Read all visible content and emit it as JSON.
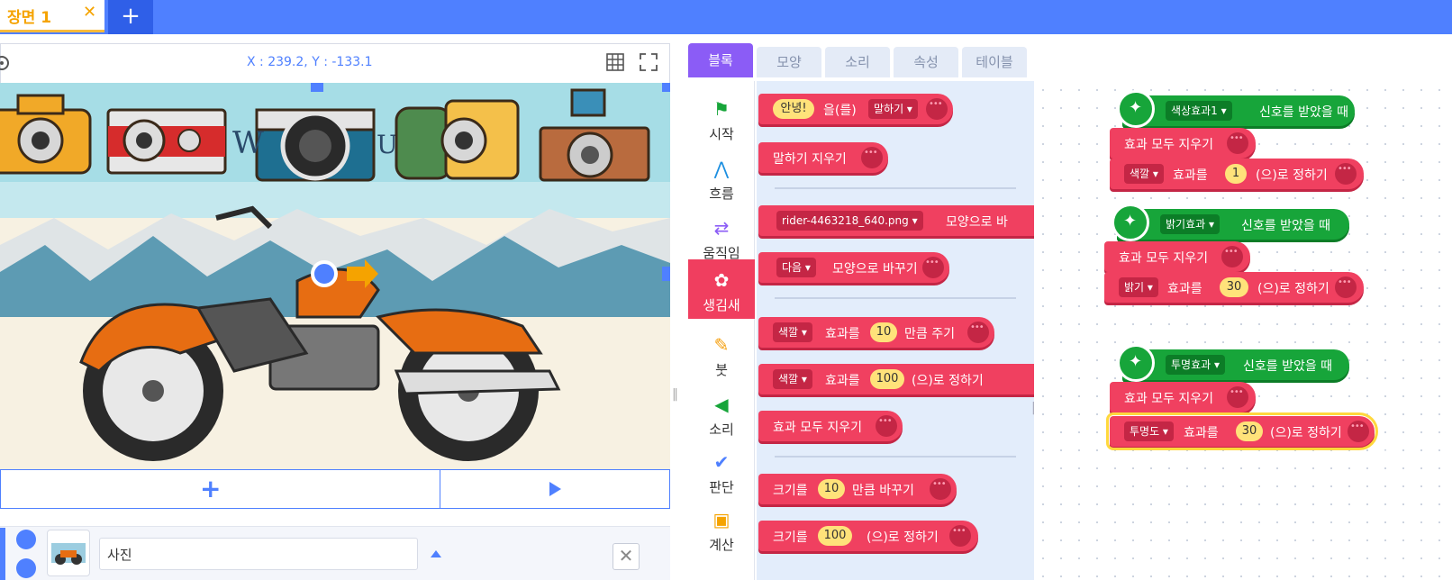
{
  "scene_tab": {
    "label": "장면 1",
    "close": "✕",
    "add": "+"
  },
  "stage": {
    "coords": "X : 239.2, Y : -133.1",
    "add_label": "+",
    "object_name": "사진"
  },
  "tabs": [
    "블록",
    "모양",
    "소리",
    "속성",
    "테이블"
  ],
  "categories": [
    {
      "label": "시작",
      "icon": "flag-icon"
    },
    {
      "label": "흐름",
      "icon": "flow-icon"
    },
    {
      "label": "움직임",
      "icon": "move-icon"
    },
    {
      "label": "생김새",
      "icon": "looks-icon"
    },
    {
      "label": "붓",
      "icon": "brush-icon"
    },
    {
      "label": "소리",
      "icon": "sound-icon"
    },
    {
      "label": "판단",
      "icon": "check-icon"
    },
    {
      "label": "계산",
      "icon": "calc-icon"
    }
  ],
  "palette": {
    "b1": {
      "pill": "안녕!",
      "t1": "을(를)",
      "drop": "말하기 ▾"
    },
    "b2": {
      "t1": "말하기 지우기"
    },
    "b3": {
      "drop": "rider-4463218_640.png ▾",
      "t1": "모양으로 바"
    },
    "b4": {
      "drop": "다음 ▾",
      "t1": "모양으로 바꾸기"
    },
    "b5": {
      "drop": "색깔 ▾",
      "t1": "효과를",
      "pill": "10",
      "t2": "만큼 주기"
    },
    "b6": {
      "drop": "색깔 ▾",
      "t1": "효과를",
      "pill": "100",
      "t2": "(으)로 정하기"
    },
    "b7": {
      "t1": "효과 모두 지우기"
    },
    "b8": {
      "t1": "크기를",
      "pill": "10",
      "t2": "만큼 바꾸기"
    },
    "b9": {
      "t1": "크기를",
      "pill": "100",
      "t2": "(으)로 정하기"
    }
  },
  "workspace": {
    "g1": {
      "signal": "색상효과1 ▾",
      "hat_text": "신호를 받았을 때",
      "clear": "효과 모두 지우기",
      "drop": "색깔 ▾",
      "t1": "효과를",
      "pill": "1",
      "t2": "(으)로 정하기"
    },
    "g2": {
      "signal": "밝기효과 ▾",
      "hat_text": "신호를 받았을 때",
      "clear": "효과 모두 지우기",
      "drop": "밝기 ▾",
      "t1": "효과를",
      "pill": "30",
      "t2": "(으)로 정하기"
    },
    "g3": {
      "signal": "투명효과 ▾",
      "hat_text": "신호를 받았을 때",
      "clear": "효과 모두 지우기",
      "drop": "투명도 ▾",
      "t1": "효과를",
      "pill": "30",
      "t2": "(으)로 정하기"
    }
  }
}
